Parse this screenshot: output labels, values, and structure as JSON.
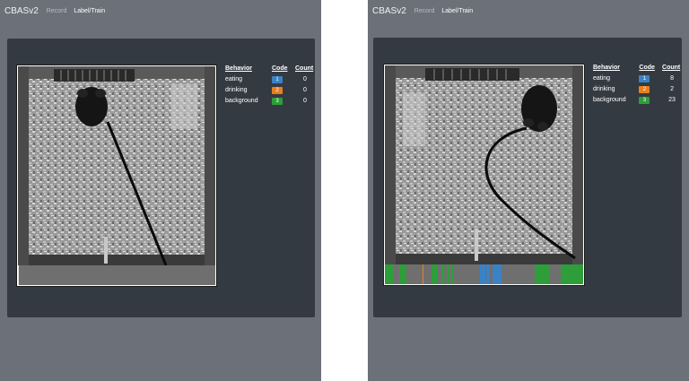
{
  "colors": {
    "app_bg": "#6c7079",
    "panel_bg": "#343a42",
    "eating": "#3b82c4",
    "drinking": "#e8801c",
    "background": "#2e9e3a"
  },
  "left": {
    "navbar": {
      "brand": "CBASv2",
      "record": "Record",
      "label_train": "Label/Train"
    },
    "table": {
      "headers": {
        "behavior": "Behavior",
        "code": "Code",
        "count": "Count"
      },
      "rows": [
        {
          "behavior": "eating",
          "code": "1",
          "count": "0"
        },
        {
          "behavior": "drinking",
          "code": "2",
          "count": "0"
        },
        {
          "behavior": "background",
          "code": "3",
          "count": "0"
        }
      ]
    }
  },
  "right": {
    "navbar": {
      "brand": "CBASv2",
      "record": "Record",
      "label_train": "Label/Train"
    },
    "table": {
      "headers": {
        "behavior": "Behavior",
        "code": "Code",
        "count": "Count"
      },
      "rows": [
        {
          "behavior": "eating",
          "code": "1",
          "count": "8"
        },
        {
          "behavior": "drinking",
          "code": "2",
          "count": "2"
        },
        {
          "behavior": "background",
          "code": "3",
          "count": "23"
        }
      ]
    }
  }
}
